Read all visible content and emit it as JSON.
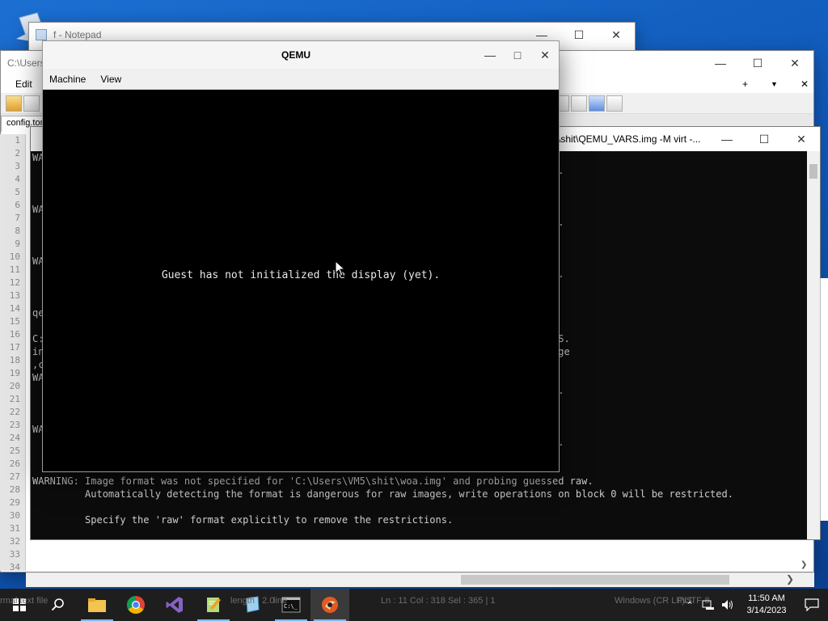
{
  "notepad_back": {
    "title": "f - Notepad"
  },
  "editor": {
    "path_fragment": "C:\\Users",
    "menu_edit": "Edit",
    "tab_label": "config.toml",
    "line_numbers": [
      "1",
      "2",
      "3",
      "4",
      "5",
      "6",
      "7",
      "8",
      "9",
      "10",
      "11",
      "12",
      "13",
      "14",
      "15",
      "16",
      "17",
      "18",
      "19",
      "20",
      "21",
      "22",
      "23",
      "24",
      "25",
      "26",
      "27",
      "28",
      "29",
      "30",
      "31",
      "32",
      "33",
      "34"
    ]
  },
  "console": {
    "title": "\\shit\\QEMU_VARS.img -M virt -...",
    "lines": [
      "WA                                                   probing guessed raw.",
      "                                                    erations on block 0 will be restricted.",
      "",
      "",
      "WA                                                   probing guessed raw.",
      "                                                    erations on block 0 will be restricted.",
      "",
      "",
      "WA                                                   ing guessed raw.",
      "                                                    erations on block 0 will be restricted.",
      "",
      "",
      "qe",
      "",
      "C:                                                   ng -pflash C:\\Users\\VM5\\shit\\QEMU_VARS.",
      "in                                                   l -device usb-mouse -device usb-storage",
      ",c",
      "WA                                                   probing guessed raw.",
      "                                                    erations on block 0 will be restricted.",
      "",
      "",
      "WA                                                   probing guessed raw.",
      "                                                    erations on block 0 will be restricted.",
      "",
      "",
      "WARNING: Image format was not specified for 'C:\\Users\\VM5\\shit\\woa.img' and probing guessed raw.",
      "         Automatically detecting the format is dangerous for raw images, write operations on block 0 will be restricted.",
      "",
      "         Specify the 'raw' format explicitly to remove the restrictions."
    ]
  },
  "qemu": {
    "title": "QEMU",
    "menu": [
      "Machine",
      "View"
    ],
    "guest_message": "Guest has not initialized the display (yet)."
  },
  "taskbar": {
    "status_left": "rmal text file",
    "status_len": "length : 2.0",
    "status_lines": "line",
    "status_pos": "Ln : 11    Col : 318    Sel : 365 | 1",
    "status_eol": "Windows (CR LF)",
    "status_enc": "UTF-8",
    "status_ins": "INS",
    "time": "11:50 AM",
    "date": "3/14/2023"
  },
  "colors": {
    "desktop": "#0f58b8",
    "console_bg": "#0c0c0c",
    "console_fg": "#cccccc",
    "taskbar": "#1e1e1e",
    "accent": "#76b9ed"
  }
}
